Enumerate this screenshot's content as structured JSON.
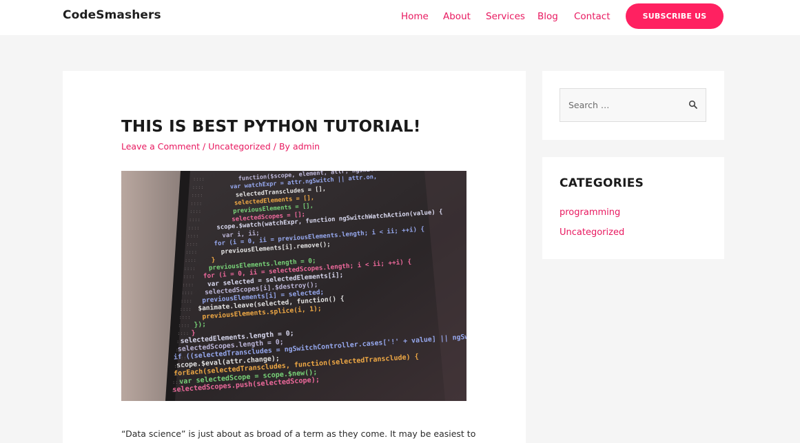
{
  "site": {
    "title": "CodeSmashers"
  },
  "nav": {
    "items": [
      {
        "label": "Home"
      },
      {
        "label": "About"
      },
      {
        "label": "Services"
      },
      {
        "label": "Blog"
      },
      {
        "label": "Contact"
      }
    ],
    "cta_label": "SUBSCRIBE US"
  },
  "post": {
    "title": "THIS IS BEST PYTHON TUTORIAL!",
    "meta": {
      "comments": "Leave a Comment",
      "category": "Uncategorized",
      "by": "By",
      "author": "admin"
    },
    "image": {
      "code_lines": [
        "function($scope, element, attr, ngSwitchController) {",
        "var watchExpr = attr.ngSwitch || attr.on,",
        "selectedTranscludes = [],",
        "selectedElements = [],",
        "previousElements = [],",
        "selectedScopes = [];",
        "scope.$watch(watchExpr, function ngSwitchWatchAction(value) {",
        "var i, ii;",
        "for (i = 0, ii = previousElements.length; i < ii; ++i) {",
        "previousElements[i].remove();",
        "}",
        "previousElements.length = 0;",
        "for (i = 0, ii = selectedScopes.length; i < ii; ++i) {",
        "var selected = selectedElements[i];",
        "selectedScopes[i].$destroy();",
        "previousElements[i] = selected;",
        "$animate.leave(selected, function() {",
        "previousElements.splice(i, 1);",
        "});",
        "}",
        "selectedElements.length = 0;",
        "selectedScopes.length = 0;",
        "if ((selectedTranscludes = ngSwitchController.cases['!' + value] || ngSwitchController",
        "scope.$eval(attr.change);",
        "forEach(selectedTranscludes, function(selectedTransclude) {",
        "var selectedScope = scope.$new();",
        "selectedScopes.push(selectedScope);"
      ]
    },
    "excerpt": "“Data science” is just about as broad of a term as they come. It may be easiest to"
  },
  "sidebar": {
    "search": {
      "placeholder": "Search …"
    },
    "categories": {
      "title": "CATEGORIES",
      "items": [
        {
          "label": "programming"
        },
        {
          "label": "Uncategorized"
        }
      ]
    }
  },
  "colors": {
    "accent": "#e8185f",
    "button": "#ff2161",
    "page_bg": "#f5f5f5",
    "code_bg": "#2a2526"
  }
}
